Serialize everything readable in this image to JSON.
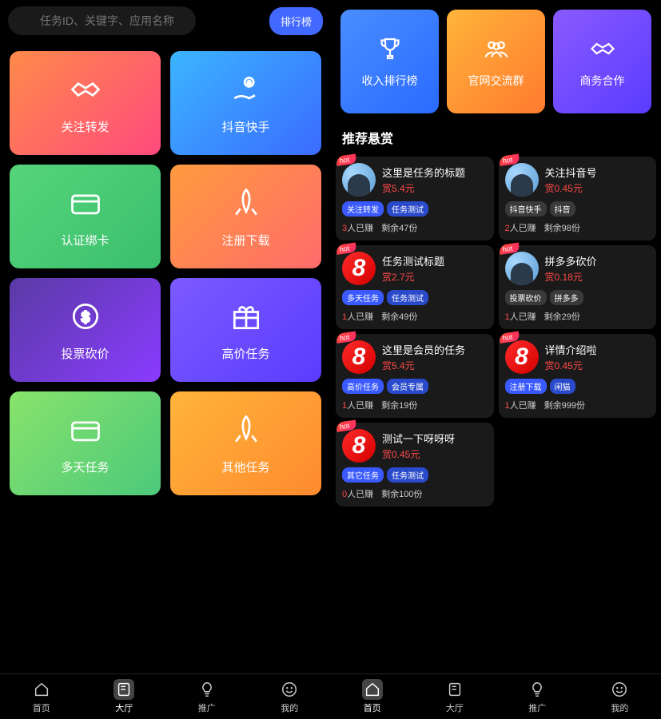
{
  "search": {
    "placeholder": "任务ID、关键字、应用名称"
  },
  "rank_btn": "排行榜",
  "categories": [
    {
      "label": "关注转发",
      "bg": "bg1",
      "icon": "handshake"
    },
    {
      "label": "抖音快手",
      "bg": "bg2",
      "icon": "coin-hand"
    },
    {
      "label": "认证绑卡",
      "bg": "bg3",
      "icon": "card"
    },
    {
      "label": "注册下载",
      "bg": "bg4",
      "icon": "rocket"
    },
    {
      "label": "投票砍价",
      "bg": "bg5",
      "icon": "coin"
    },
    {
      "label": "高价任务",
      "bg": "bg6",
      "icon": "gift"
    },
    {
      "label": "多天任务",
      "bg": "bg7",
      "icon": "card"
    },
    {
      "label": "其他任务",
      "bg": "bg8",
      "icon": "rocket"
    }
  ],
  "top_cards": [
    {
      "label": "收入排行榜",
      "bg": "top1",
      "icon": "trophy"
    },
    {
      "label": "官网交流群",
      "bg": "top2",
      "icon": "group"
    },
    {
      "label": "商务合作",
      "bg": "top3",
      "icon": "handshake"
    }
  ],
  "section_recommend": "推荐悬赏",
  "tasks": [
    {
      "title": "这里是任务的标题",
      "reward": "赏5.4元",
      "tags": [
        {
          "t": "关注转发",
          "c": "blue"
        },
        {
          "t": "任务测试",
          "c": "dblue"
        }
      ],
      "done": "3",
      "remain": "剩余47份",
      "avatar": "photo",
      "hot": "hot"
    },
    {
      "title": "关注抖音号",
      "reward": "赏0.45元",
      "tags": [
        {
          "t": "抖音快手",
          "c": "gray"
        },
        {
          "t": "抖音",
          "c": "gray"
        }
      ],
      "done": "2",
      "remain": "剩余98份",
      "avatar": "photo",
      "hot": "hot"
    },
    {
      "title": "任务测试标题",
      "reward": "赏2.7元",
      "tags": [
        {
          "t": "多天任务",
          "c": "blue"
        },
        {
          "t": "任务测试",
          "c": "dblue"
        }
      ],
      "done": "1",
      "remain": "剩余49份",
      "avatar": "eight",
      "hot": "hot"
    },
    {
      "title": "拼多多砍价",
      "reward": "赏0.18元",
      "tags": [
        {
          "t": "投票砍价",
          "c": "gray"
        },
        {
          "t": "拼多多",
          "c": "gray"
        }
      ],
      "done": "1",
      "remain": "剩余29份",
      "avatar": "photo",
      "hot": "hot"
    },
    {
      "title": "这里是会员的任务",
      "reward": "赏5.4元",
      "tags": [
        {
          "t": "高价任务",
          "c": "blue"
        },
        {
          "t": "会员专属",
          "c": "dblue"
        }
      ],
      "done": "1",
      "remain": "剩余19份",
      "avatar": "eight",
      "hot": "hot"
    },
    {
      "title": "详情介绍啦",
      "reward": "赏0.45元",
      "tags": [
        {
          "t": "注册下载",
          "c": "blue"
        },
        {
          "t": "闲猫",
          "c": "dblue"
        }
      ],
      "done": "1",
      "remain": "剩余999份",
      "avatar": "eight",
      "hot": "hot"
    },
    {
      "title": "测试一下呀呀呀",
      "reward": "赏0.45元",
      "tags": [
        {
          "t": "其它任务",
          "c": "blue"
        },
        {
          "t": "任务测试",
          "c": "dblue"
        }
      ],
      "done": "0",
      "remain": "剩余100份",
      "avatar": "eight",
      "hot": "hot"
    }
  ],
  "done_suffix": "人已赚",
  "tabs": [
    {
      "label": "首页",
      "icon": "home"
    },
    {
      "label": "大厅",
      "icon": "hall"
    },
    {
      "label": "推广",
      "icon": "bulb"
    },
    {
      "label": "我的",
      "icon": "smile"
    }
  ],
  "active_tab_left": 1,
  "active_tab_right": 0
}
